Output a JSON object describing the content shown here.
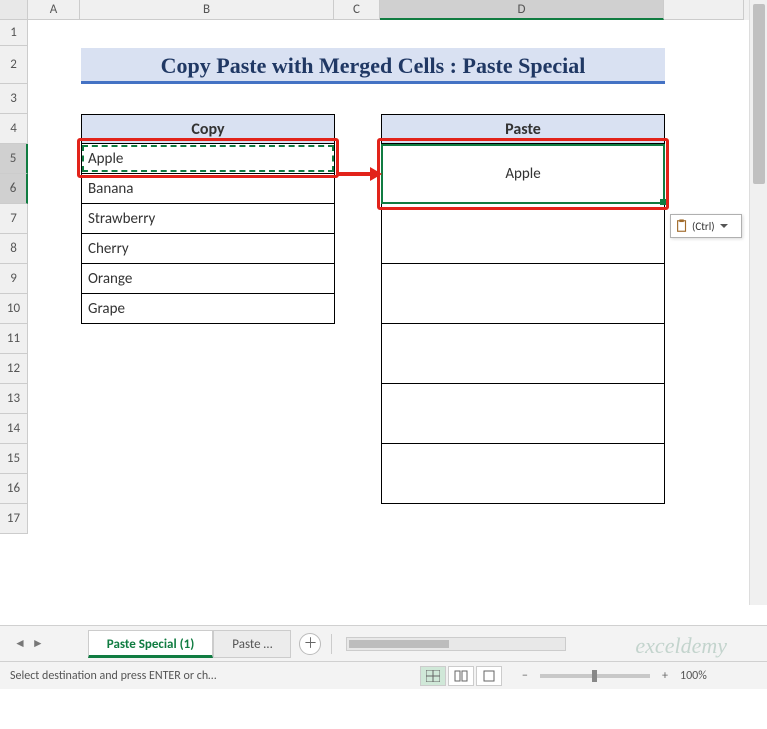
{
  "title": "Copy Paste with Merged Cells : Paste Special",
  "columns": [
    "A",
    "B",
    "C",
    "D"
  ],
  "rows": [
    "1",
    "2",
    "3",
    "4",
    "5",
    "6",
    "7",
    "8",
    "9",
    "10",
    "11",
    "12",
    "13",
    "14",
    "15",
    "16",
    "17"
  ],
  "copy": {
    "header": "Copy",
    "items": [
      "Apple",
      "Banana",
      "Strawberry",
      "Cherry",
      "Orange",
      "Grape"
    ]
  },
  "paste": {
    "header": "Paste",
    "value": "Apple"
  },
  "paste_options_label": "(Ctrl)",
  "tabs": {
    "active": "Paste Special (1)",
    "other": "Paste …"
  },
  "status_text": "Select destination and press ENTER or ch…",
  "zoom_label": "100%",
  "watermark": "exceldemy",
  "chart_data": {
    "type": "table",
    "title": "Copy Paste with Merged Cells : Paste Special",
    "columns": [
      "Copy",
      "Paste"
    ],
    "rows": [
      [
        "Apple",
        "Apple"
      ],
      [
        "Banana",
        ""
      ],
      [
        "Strawberry",
        ""
      ],
      [
        "Cherry",
        ""
      ],
      [
        "Orange",
        ""
      ],
      [
        "Grape",
        ""
      ]
    ],
    "notes": "Column B single-row cells copied; Column D uses 2-row merged cells; B5 has copy marquee; D5:D6 is active paste target."
  }
}
